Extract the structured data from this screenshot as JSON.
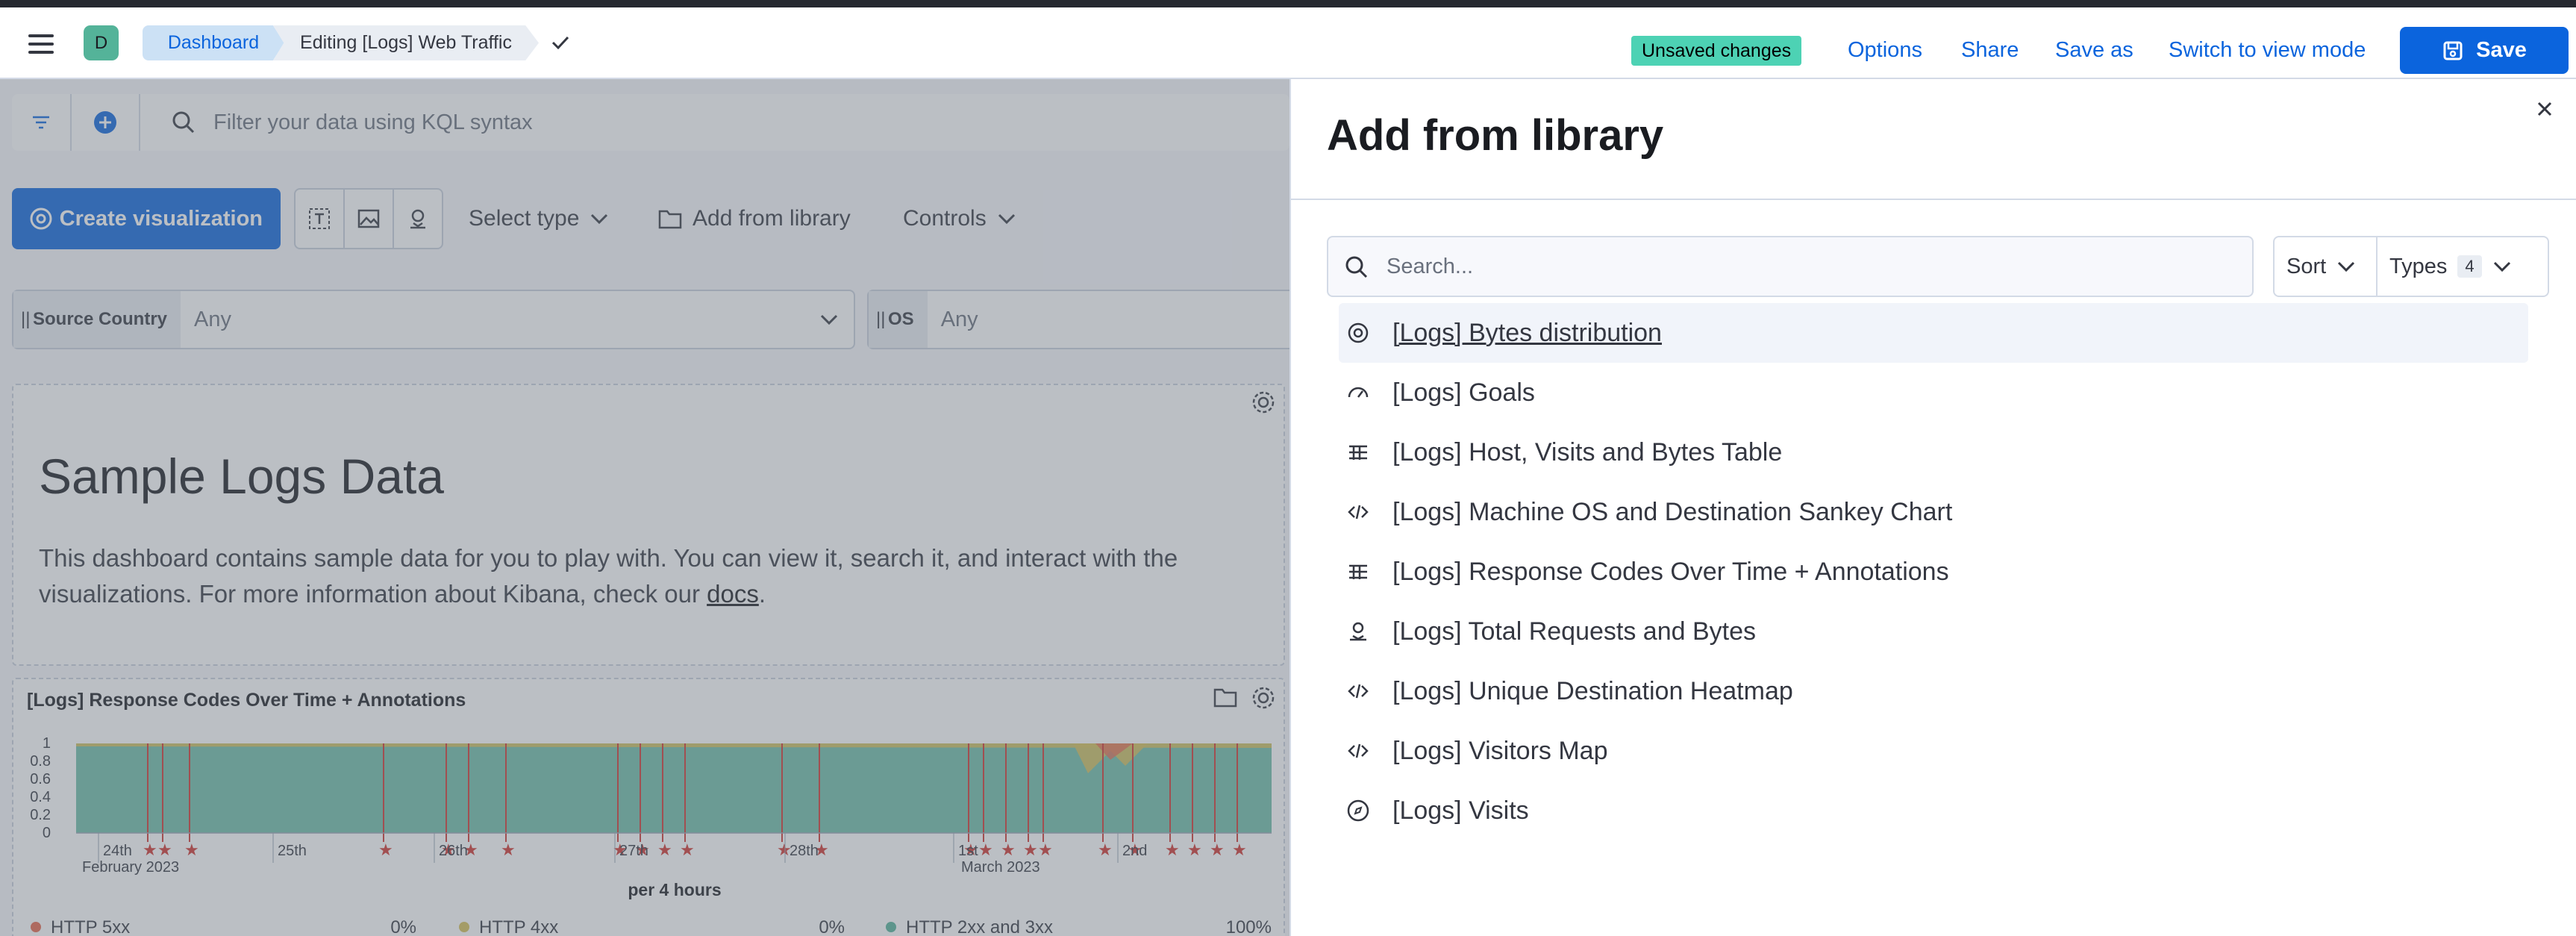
{
  "header": {
    "avatar": "D",
    "breadcrumb": [
      "Dashboard",
      "Editing [Logs] Web Traffic"
    ],
    "badge": "Unsaved changes",
    "links": [
      "Options",
      "Share",
      "Save as",
      "Switch to view mode"
    ],
    "save": "Save"
  },
  "query": {
    "placeholder": "Filter your data using KQL syntax"
  },
  "toolbar": {
    "create": "Create visualization",
    "select_type": "Select type",
    "add_library": "Add from library",
    "controls": "Controls"
  },
  "controls": [
    {
      "label": "Source Country",
      "value": "Any"
    },
    {
      "label": "OS",
      "value": "Any"
    }
  ],
  "panel_markdown": {
    "title": "Sample Logs Data",
    "text_before": "This dashboard contains sample data for you to play with. You can view it, search it, and interact with the visualizations. For more information about Kibana, check our ",
    "link": "docs",
    "text_after": "."
  },
  "panel_chart": {
    "title": "[Logs] Response Codes Over Time + Annotations",
    "x_title": "per 4 hours",
    "chart_data": {
      "type": "area",
      "y_ticks": [
        "1",
        "0.8",
        "0.6",
        "0.4",
        "0.2",
        "0"
      ],
      "x_ticks": [
        "24th",
        "25th",
        "26th",
        "27th",
        "28th",
        "1st",
        "2nd"
      ],
      "x_sub": [
        "February 2023",
        "March 2023"
      ],
      "ylim": [
        0,
        1
      ],
      "series": [
        {
          "name": "HTTP 5xx",
          "value": "0%",
          "color": "#e7664c"
        },
        {
          "name": "HTTP 4xx",
          "value": "0%",
          "color": "#d6bf57"
        },
        {
          "name": "HTTP 2xx and 3xx",
          "value": "100%",
          "color": "#54b399"
        }
      ]
    }
  },
  "flyout": {
    "title": "Add from library",
    "search_placeholder": "Search...",
    "sort": "Sort",
    "types": "Types",
    "types_count": "4",
    "items": [
      {
        "icon": "lens",
        "label": "[Logs] Bytes distribution"
      },
      {
        "icon": "gauge",
        "label": "[Logs] Goals"
      },
      {
        "icon": "table",
        "label": "[Logs] Host, Visits and Bytes Table"
      },
      {
        "icon": "code",
        "label": "[Logs] Machine OS and Destination Sankey Chart"
      },
      {
        "icon": "table",
        "label": "[Logs] Response Codes Over Time + Annotations"
      },
      {
        "icon": "map",
        "label": "[Logs] Total Requests and Bytes"
      },
      {
        "icon": "code",
        "label": "[Logs] Unique Destination Heatmap"
      },
      {
        "icon": "code",
        "label": "[Logs] Visitors Map"
      },
      {
        "icon": "compass",
        "label": "[Logs] Visits"
      }
    ]
  }
}
